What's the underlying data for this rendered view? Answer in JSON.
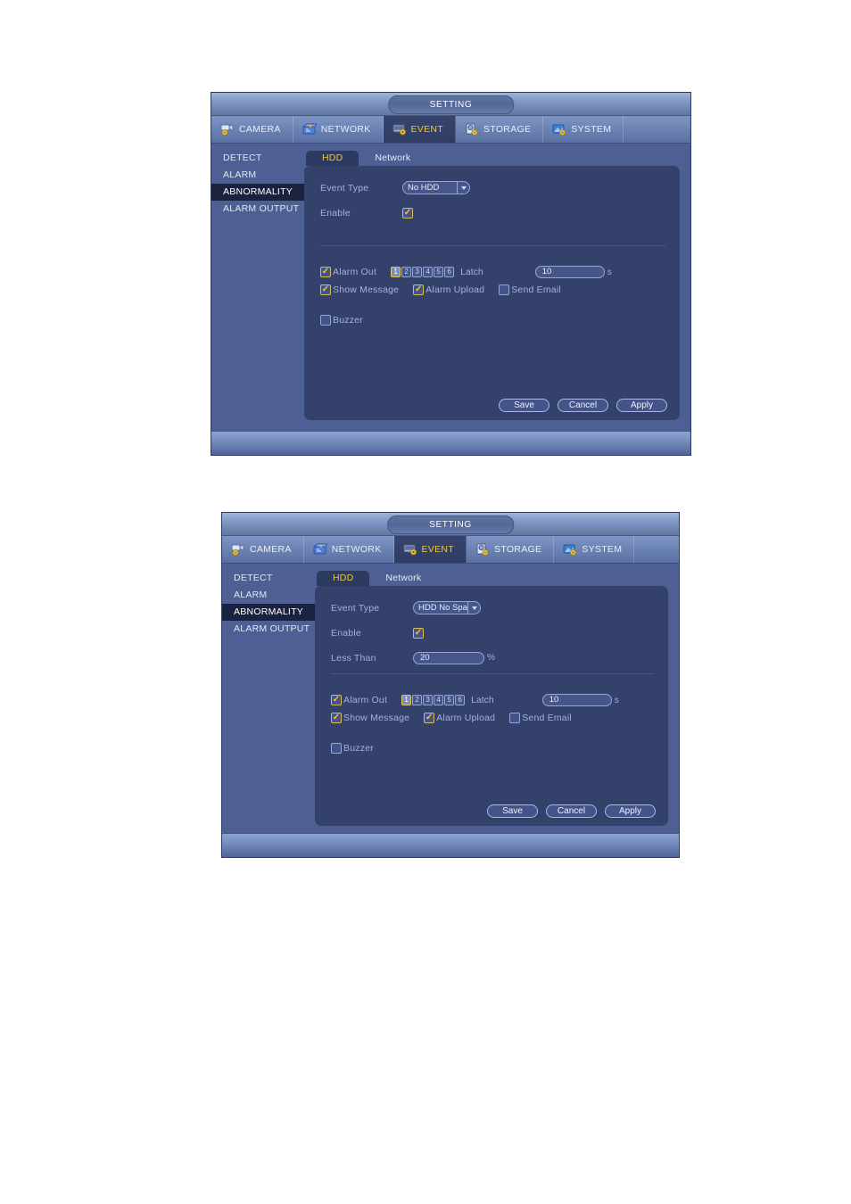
{
  "panels": [
    {
      "title": "SETTING",
      "tabs": [
        {
          "label": "CAMERA",
          "icon": "camera-icon",
          "active": false
        },
        {
          "label": "NETWORK",
          "icon": "network-icon",
          "active": false
        },
        {
          "label": "EVENT",
          "icon": "event-icon",
          "active": true
        },
        {
          "label": "STORAGE",
          "icon": "storage-icon",
          "active": false
        },
        {
          "label": "SYSTEM",
          "icon": "system-icon",
          "active": false
        }
      ],
      "sidenav": [
        {
          "label": "DETECT",
          "selected": false
        },
        {
          "label": "ALARM",
          "selected": false
        },
        {
          "label": "ABNORMALITY",
          "selected": true
        },
        {
          "label": "ALARM OUTPUT",
          "selected": false
        }
      ],
      "subtabs": [
        {
          "label": "HDD",
          "active": true
        },
        {
          "label": "Network",
          "active": false
        }
      ],
      "form": {
        "event_type_label": "Event Type",
        "event_type_value": "No HDD",
        "enable_label": "Enable",
        "enable_checked": true,
        "has_less_than": false,
        "less_than_label": "",
        "less_than_value": "",
        "less_than_unit": ""
      },
      "alarm": {
        "alarm_out_label": "Alarm Out",
        "alarm_out_checked": true,
        "channels": [
          "1",
          "2",
          "3",
          "4",
          "5",
          "6"
        ],
        "channels_selected": [
          true,
          false,
          false,
          false,
          false,
          false
        ],
        "latch_label": "Latch",
        "latch_value": "10",
        "latch_unit": "s",
        "show_message_label": "Show Message",
        "show_message_checked": true,
        "alarm_upload_label": "Alarm Upload",
        "alarm_upload_checked": true,
        "send_email_label": "Send Email",
        "send_email_checked": false,
        "buzzer_label": "Buzzer",
        "buzzer_checked": false
      },
      "buttons": {
        "save": "Save",
        "cancel": "Cancel",
        "apply": "Apply"
      }
    },
    {
      "title": "SETTING",
      "tabs": [
        {
          "label": "CAMERA",
          "icon": "camera-icon",
          "active": false
        },
        {
          "label": "NETWORK",
          "icon": "network-icon",
          "active": false
        },
        {
          "label": "EVENT",
          "icon": "event-icon",
          "active": true
        },
        {
          "label": "STORAGE",
          "icon": "storage-icon",
          "active": false
        },
        {
          "label": "SYSTEM",
          "icon": "system-icon",
          "active": false
        }
      ],
      "sidenav": [
        {
          "label": "DETECT",
          "selected": false
        },
        {
          "label": "ALARM",
          "selected": false
        },
        {
          "label": "ABNORMALITY",
          "selected": true
        },
        {
          "label": "ALARM OUTPUT",
          "selected": false
        }
      ],
      "subtabs": [
        {
          "label": "HDD",
          "active": true
        },
        {
          "label": "Network",
          "active": false
        }
      ],
      "form": {
        "event_type_label": "Event Type",
        "event_type_value": "HDD No Space",
        "enable_label": "Enable",
        "enable_checked": true,
        "has_less_than": true,
        "less_than_label": "Less Than",
        "less_than_value": "20",
        "less_than_unit": "%"
      },
      "alarm": {
        "alarm_out_label": "Alarm Out",
        "alarm_out_checked": true,
        "channels": [
          "1",
          "2",
          "3",
          "4",
          "5",
          "6"
        ],
        "channels_selected": [
          true,
          false,
          false,
          false,
          false,
          false
        ],
        "latch_label": "Latch",
        "latch_value": "10",
        "latch_unit": "s",
        "show_message_label": "Show Message",
        "show_message_checked": true,
        "alarm_upload_label": "Alarm Upload",
        "alarm_upload_checked": true,
        "send_email_label": "Send Email",
        "send_email_checked": false,
        "buzzer_label": "Buzzer",
        "buzzer_checked": false
      },
      "buttons": {
        "save": "Save",
        "cancel": "Cancel",
        "apply": "Apply"
      }
    }
  ],
  "colors": {
    "accent_yellow": "#f2c43c",
    "panel_bg": "#4e6093",
    "card_bg": "#34426b",
    "label_blue": "#9fb3dd",
    "selected_nav": "#1b2240"
  }
}
